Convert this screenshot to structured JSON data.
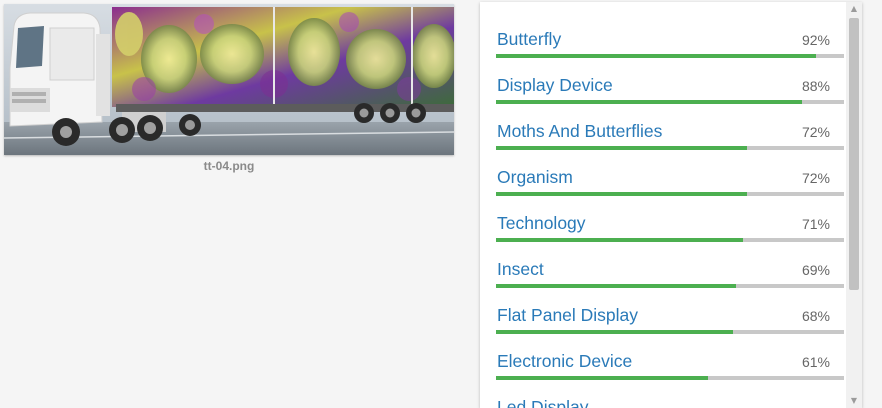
{
  "image": {
    "caption": "tt-04.png",
    "subject": "truck-with-butterfly-trailer"
  },
  "labels": [
    {
      "name": "Butterfly",
      "percent_text": "92%",
      "score": 0.92
    },
    {
      "name": "Display Device",
      "percent_text": "88%",
      "score": 0.88
    },
    {
      "name": "Moths And Butterflies",
      "percent_text": "72%",
      "score": 0.72
    },
    {
      "name": "Organism",
      "percent_text": "72%",
      "score": 0.72
    },
    {
      "name": "Technology",
      "percent_text": "71%",
      "score": 0.71
    },
    {
      "name": "Insect",
      "percent_text": "69%",
      "score": 0.69
    },
    {
      "name": "Flat Panel Display",
      "percent_text": "68%",
      "score": 0.68
    },
    {
      "name": "Electronic Device",
      "percent_text": "61%",
      "score": 0.61
    },
    {
      "name": "Led Display",
      "percent_text": "",
      "score": null
    }
  ],
  "colors": {
    "label_link": "#2a7ab8",
    "bar_fill": "#4caf50",
    "bar_track": "#c8c8c8"
  },
  "scrollbar": {
    "up_icon": "▲",
    "down_icon": "▼"
  }
}
